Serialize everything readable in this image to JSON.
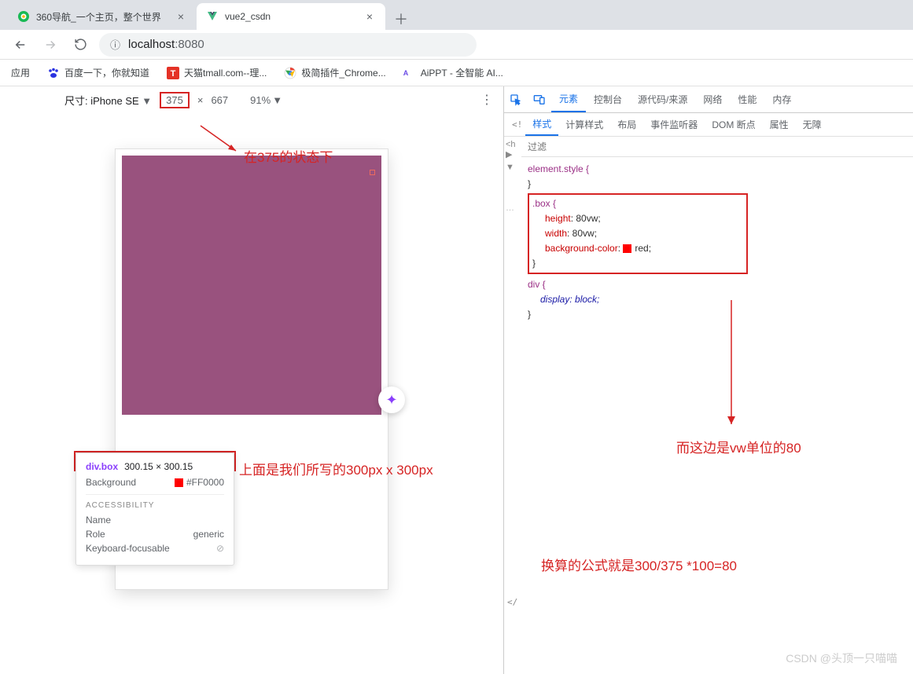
{
  "tabs": [
    {
      "title": "360导航_一个主页，整个世界",
      "favicon": "360"
    },
    {
      "title": "vue2_csdn",
      "favicon": "vue"
    }
  ],
  "address": {
    "host": "localhost",
    "port": ":8080",
    "info_icon": "ⓘ"
  },
  "nav": {
    "back": "←",
    "forward": "→",
    "reload": "⟳"
  },
  "bookmarks": {
    "apps_label": "应用",
    "items": [
      {
        "label": "百度一下，你就知道"
      },
      {
        "label": "天猫tmall.com--理..."
      },
      {
        "label": "极简插件_Chrome..."
      },
      {
        "label": "AiPPT - 全智能 AI..."
      }
    ]
  },
  "dev_toolbar": {
    "size_label": "尺寸: iPhone SE",
    "width": "375",
    "sep": "×",
    "height": "667",
    "zoom": "91%",
    "kebab": "⋮"
  },
  "tooltip": {
    "selector": "div.box",
    "dims": "300.15 × 300.15",
    "bg_label": "Background",
    "bg_value": "#FF0000",
    "acc_header": "ACCESSIBILITY",
    "name_label": "Name",
    "role_label": "Role",
    "role_value": "generic",
    "kbd_label": "Keyboard-focusable",
    "kbd_value": "⊘"
  },
  "devtools": {
    "tabs": [
      "元素",
      "控制台",
      "源代码/来源",
      "网络",
      "性能",
      "内存"
    ],
    "subtabs": [
      "样式",
      "计算样式",
      "布局",
      "事件监听器",
      "DOM 断点",
      "属性",
      "无障"
    ],
    "filter_placeholder": "过滤",
    "elements_hint": "<!",
    "h_tag": "<h",
    "close_tag": "</",
    "elstyle": "element.style {",
    "brace_close": "}",
    "box_rule": {
      "sel": ".box {",
      "height_p": "height",
      "height_v": ": 80vw;",
      "width_p": "width",
      "width_v": ": 80vw;",
      "bg_p": "background-color",
      "bg_v_pre": ": ",
      "bg_v_post": "red;"
    },
    "div_rule": {
      "sel": "div {",
      "display_p": "display",
      "display_v": ": block;"
    }
  },
  "annotations": {
    "a1": "在375的状态下",
    "a2": "上面是我们所写的300px  x 300px",
    "a3": "而这边是vw单位的80",
    "a4": "换算的公式就是300/375 *100=80"
  },
  "watermark": "CSDN @头顶一只喵喵"
}
